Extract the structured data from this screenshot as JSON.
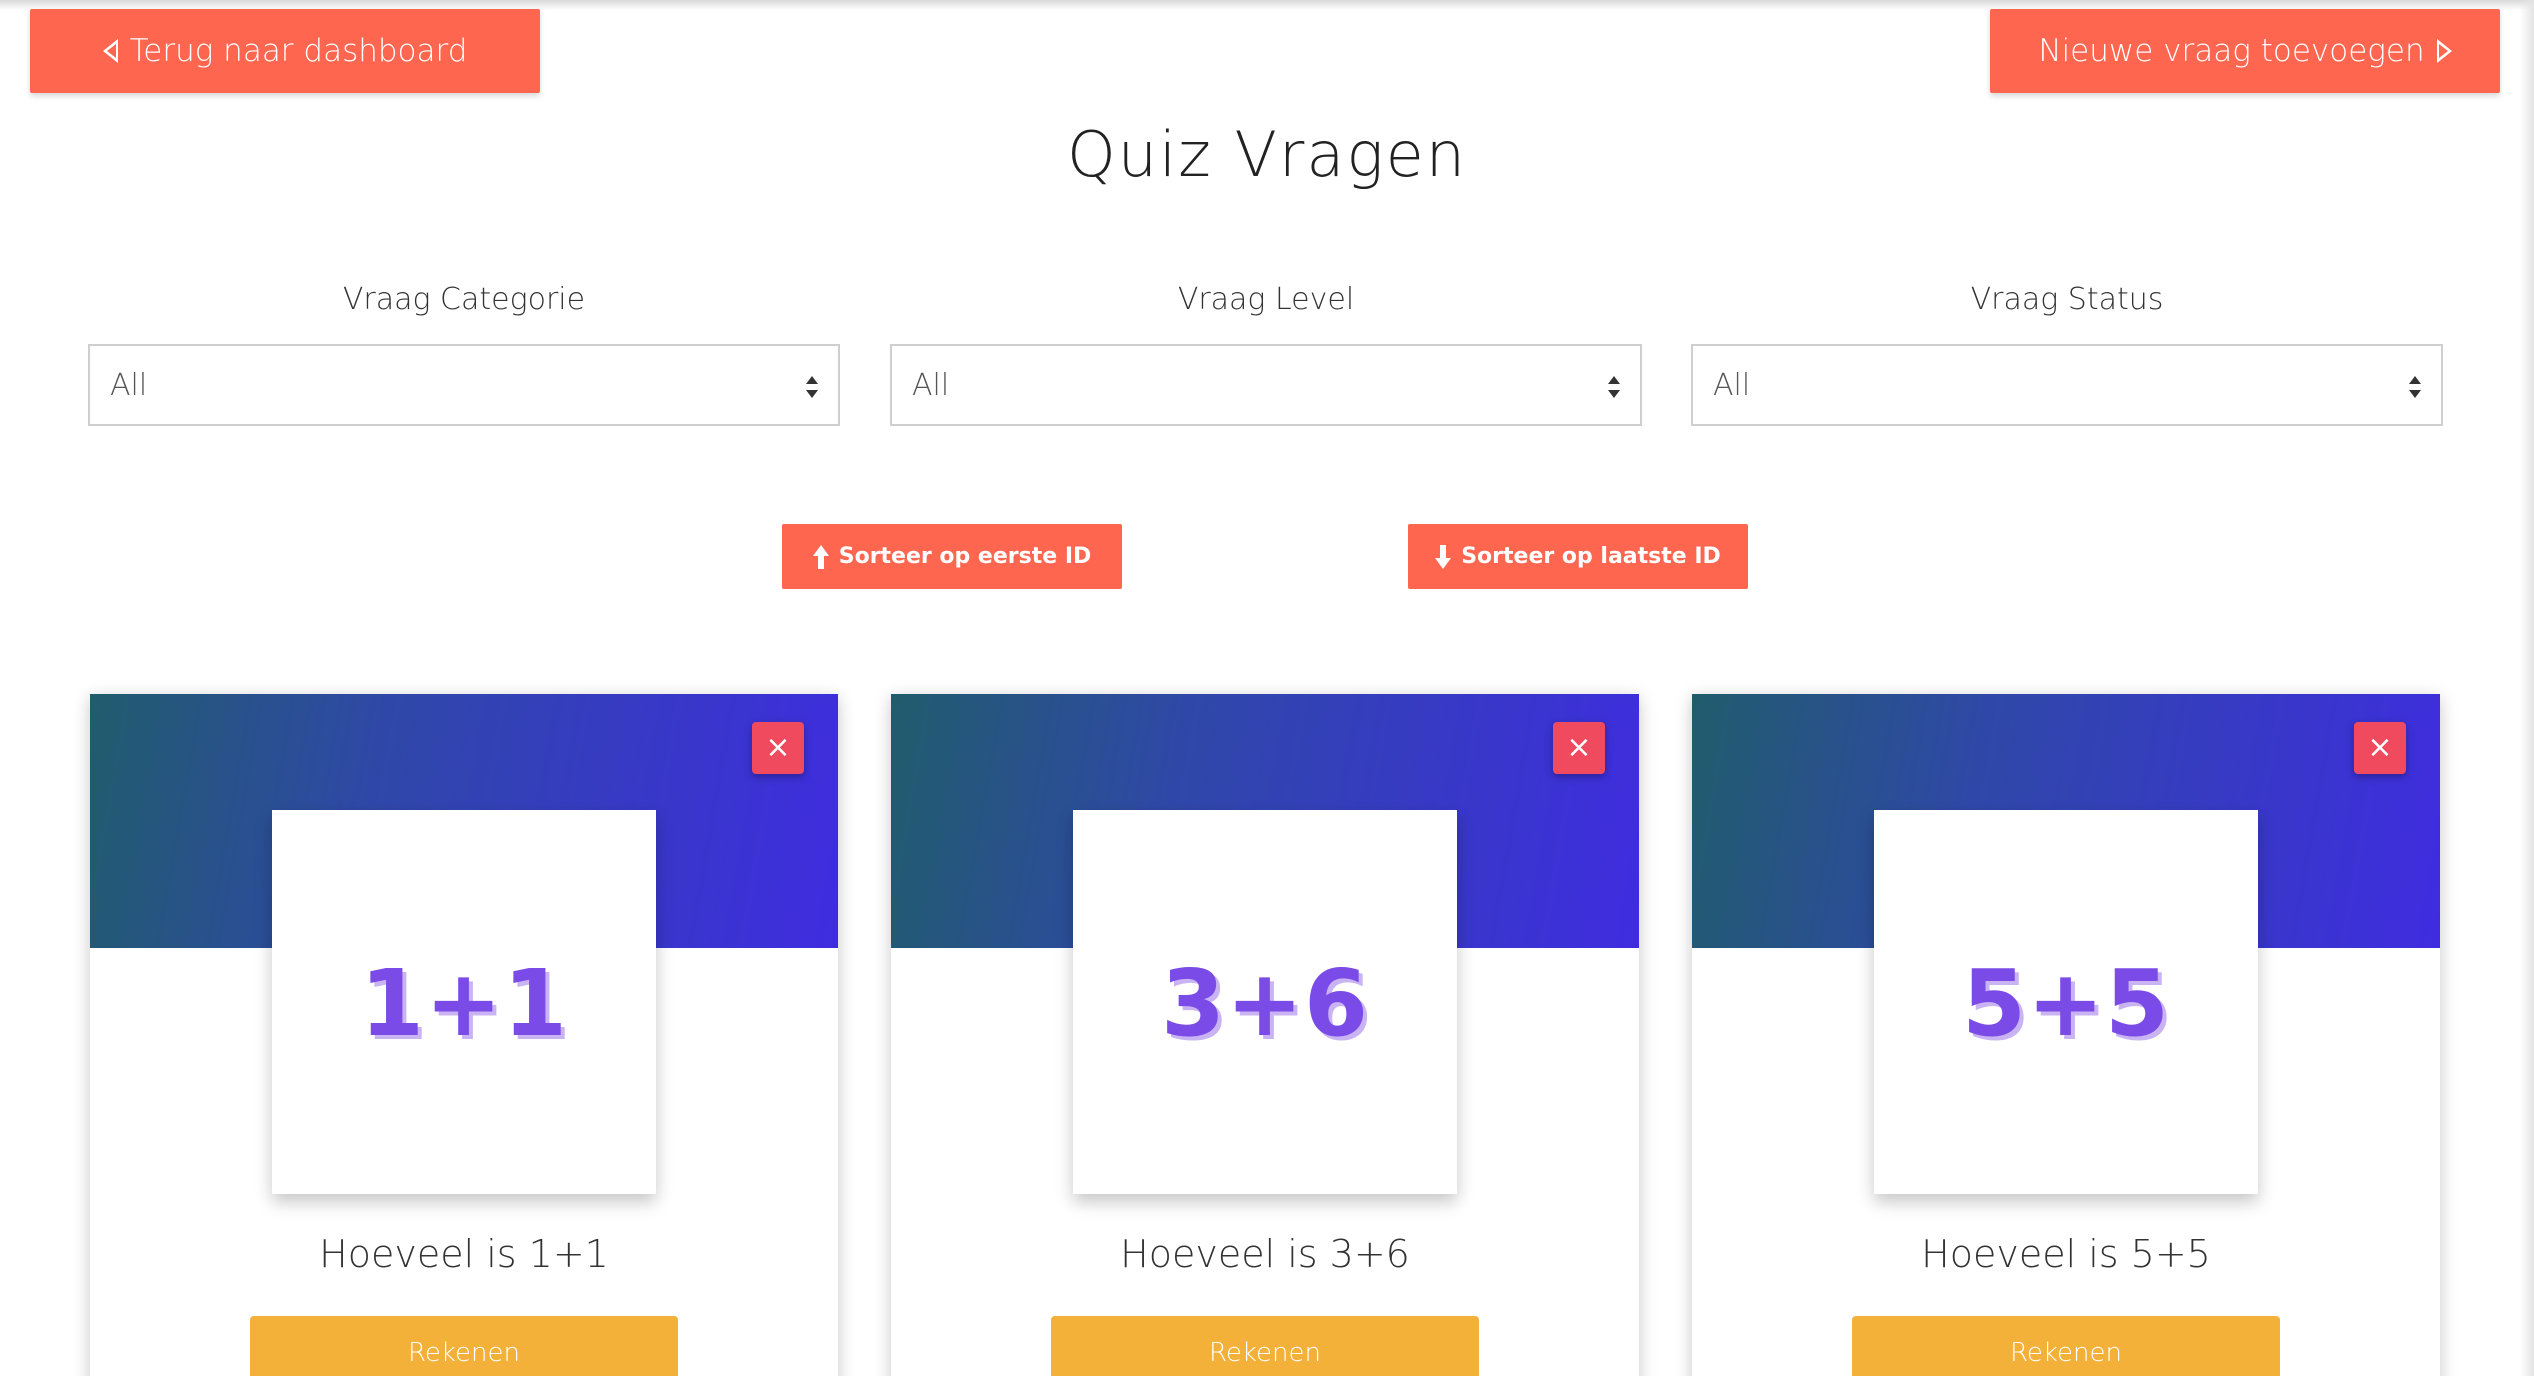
{
  "header": {
    "back_label": "Terug naar dashboard",
    "new_label": "Nieuwe vraag toevoegen"
  },
  "page_title": "Quiz Vragen",
  "filters": [
    {
      "label": "Vraag Categorie",
      "value": "All"
    },
    {
      "label": "Vraag Level",
      "value": "All"
    },
    {
      "label": "Vraag Status",
      "value": "All"
    }
  ],
  "sort": {
    "first_label": "Sorteer op eerste ID",
    "last_label": "Sorteer op laatste ID"
  },
  "cards": [
    {
      "image_text": "1+1",
      "question": "Hoeveel is 1+1",
      "category": "Rekenen",
      "close": "×"
    },
    {
      "image_text": "3+6",
      "question": "Hoeveel is 3+6",
      "category": "Rekenen",
      "close": "×"
    },
    {
      "image_text": "5+5",
      "question": "Hoeveel is 5+5",
      "category": "Rekenen",
      "close": "×"
    }
  ],
  "colors": {
    "coral": "#ff6650",
    "amber": "#f3b13a",
    "close_red": "#ef4a5e",
    "header_gradient_start": "#215c6c",
    "header_gradient_end": "#3f2ce0",
    "sum_purple": "#7a4be6"
  },
  "icons": {
    "back": "triangle-left-icon",
    "new": "triangle-right-icon",
    "sort_first": "arrow-up-icon",
    "sort_last": "arrow-down-icon",
    "close": "close-icon"
  }
}
